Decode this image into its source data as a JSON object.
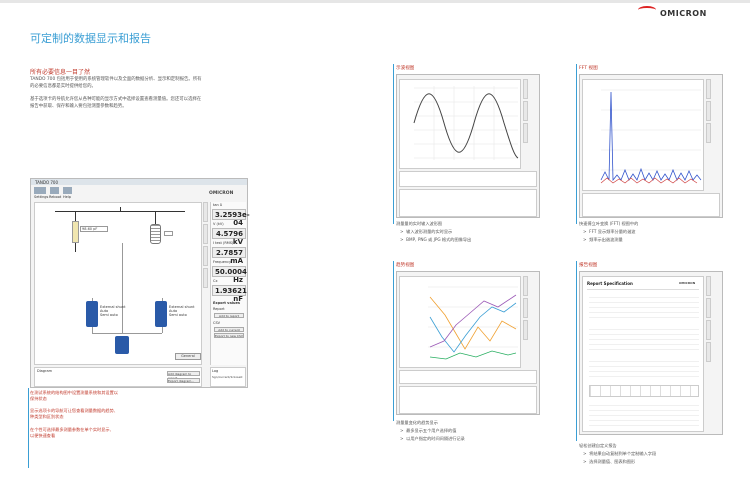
{
  "brand": "OMICRON",
  "title": "可定制的数据显示和报告",
  "intro": {
    "heading": "所有必要信息一目了然",
    "p1": [
      "TANDO 700 包括用于使用的系统管理软件以及全面的数据分析、显示和定制报告。所有",
      "的必要信息都是实时提供给您的。"
    ],
    "p2": [
      "基于选项卡的导航允许您从各种可能的显示方式中选择设置查看测量值。您还可以选择在",
      "报告中获取、保存和输入要包括测量参数和趋势。"
    ]
  },
  "app": {
    "window_title": "TANDO 700",
    "menu": [
      "Settings",
      "Reboot",
      "Help"
    ],
    "readings": [
      {
        "label": "tan δ",
        "value": "3.2593e-04"
      },
      {
        "label": "V (kV)",
        "value": "4.5796 kV"
      },
      {
        "label": "I test (RMS)",
        "value": "2.7857 mA"
      },
      {
        "label": "Frequency",
        "value": "50.0004 Hz"
      },
      {
        "label": "Cx",
        "value": "1.93621 nF"
      }
    ],
    "export_title": "Export values",
    "report_label": "Report",
    "add_report": "Add to report",
    "csv_label": "CSV",
    "add_csv": "Add to current CSV",
    "export_csv": "Export to new CSV",
    "ref_value": "98.60 pF",
    "left_options": [
      "External shunt",
      "Auto",
      "Semi auto"
    ],
    "right_options": [
      "External shunt",
      "Auto",
      "Semi auto"
    ],
    "diagram_label": "Diagram",
    "general_btn": "General",
    "add_diagram": "Add diagram to report",
    "export_diagram": "Export diagram...",
    "log_label": "Log",
    "log_value": "Sgn/current/1nlose0"
  },
  "callouts": [
    [
      "在测试系统的结构图中设置测量系统和其设置以",
      "保持状态"
    ],
    [
      "显示选项卡的导航可让您查看测量数据的趋势、",
      "种类型和区别状态"
    ],
    [
      "在个性可选择最多测量参数在单个实时显示、",
      "以便快速查看"
    ]
  ],
  "views": {
    "wave": {
      "label": "示波视图",
      "caption": "测量量的实时输入波形图",
      "bullets": [
        "输入波形测量的实时显示",
        "BMP, PNG 或 JPG 格式的图像导出"
      ]
    },
    "fft": {
      "label": "FFT 视图",
      "caption": "快速傅立叶变换 (FFT) 视图中的",
      "bullets": [
        "FFT 显示频率分量的谐波",
        "频率示出谐波测量"
      ]
    },
    "trend": {
      "label": "趋势视图",
      "caption": "测量量变化的趋势显示",
      "bullets": [
        "最多显示五个用户选择的值",
        "以用户指定的时间间隔进行记录"
      ]
    },
    "report": {
      "label": "报告视图",
      "heading": "Report Specification",
      "caption": "轻松创建自定义报告",
      "bullets": [
        "将结果自动复制到单个定制输入字段",
        "选择测量值、图表和图形"
      ]
    }
  },
  "colors": {
    "accent": "#3a9ed4",
    "red": "#c0392b"
  }
}
